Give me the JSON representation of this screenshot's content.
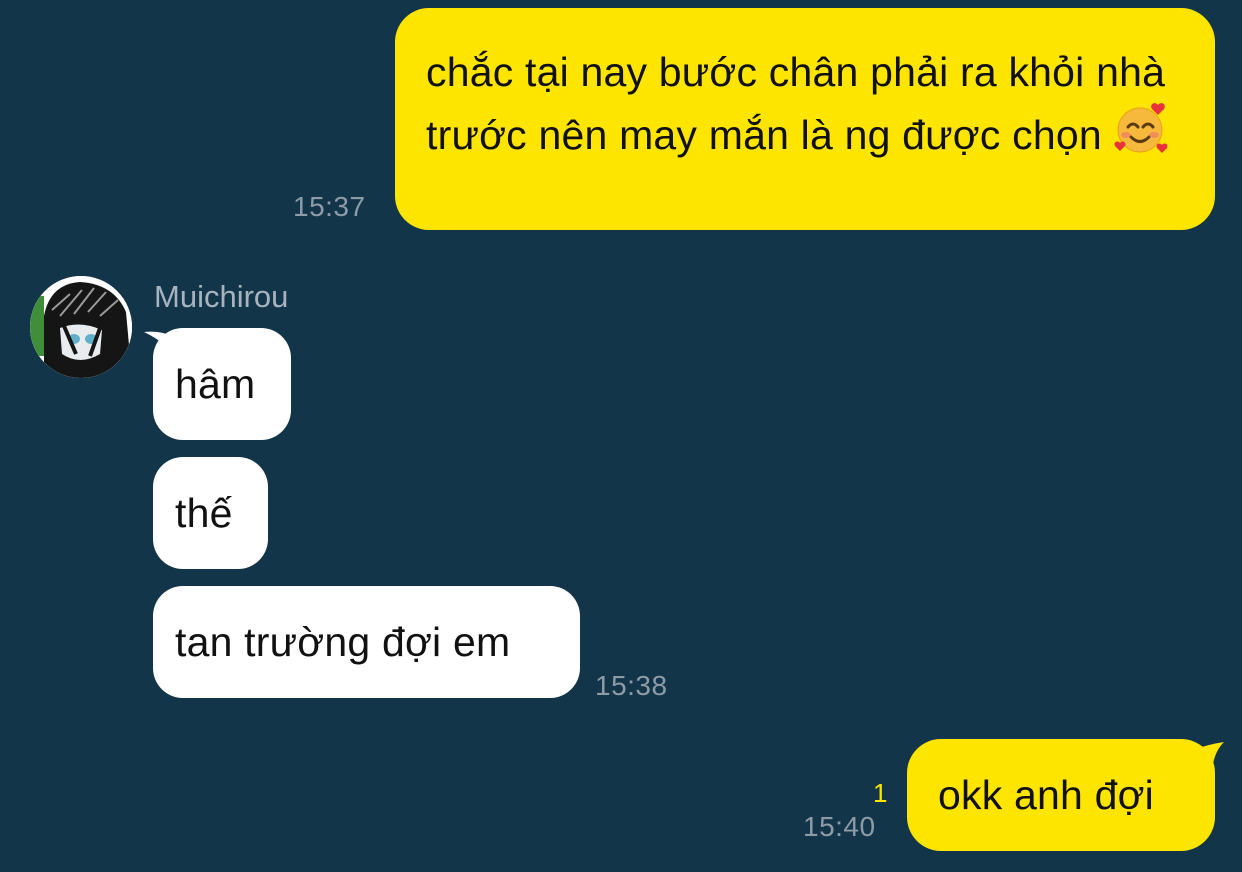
{
  "messages": {
    "m1": {
      "text": "chắc tại nay bước chân phải ra khỏi nhà trước nên may mắn là ng được chọn",
      "emoji": "smiling-face-with-hearts-icon",
      "time": "15:37"
    },
    "sender": {
      "name": "Muichirou"
    },
    "m2": {
      "text": "hâm"
    },
    "m3": {
      "text": "thế"
    },
    "m4": {
      "text": "tan trường đợi em",
      "time": "15:38"
    },
    "m5": {
      "text": "okk anh đợi",
      "time": "15:40",
      "unread": "1"
    }
  },
  "colors": {
    "background": "#13354a",
    "my_bubble": "#fee500",
    "their_bubble": "#ffffff",
    "timestamp": "#8d9ba6",
    "unread": "#fee500"
  }
}
